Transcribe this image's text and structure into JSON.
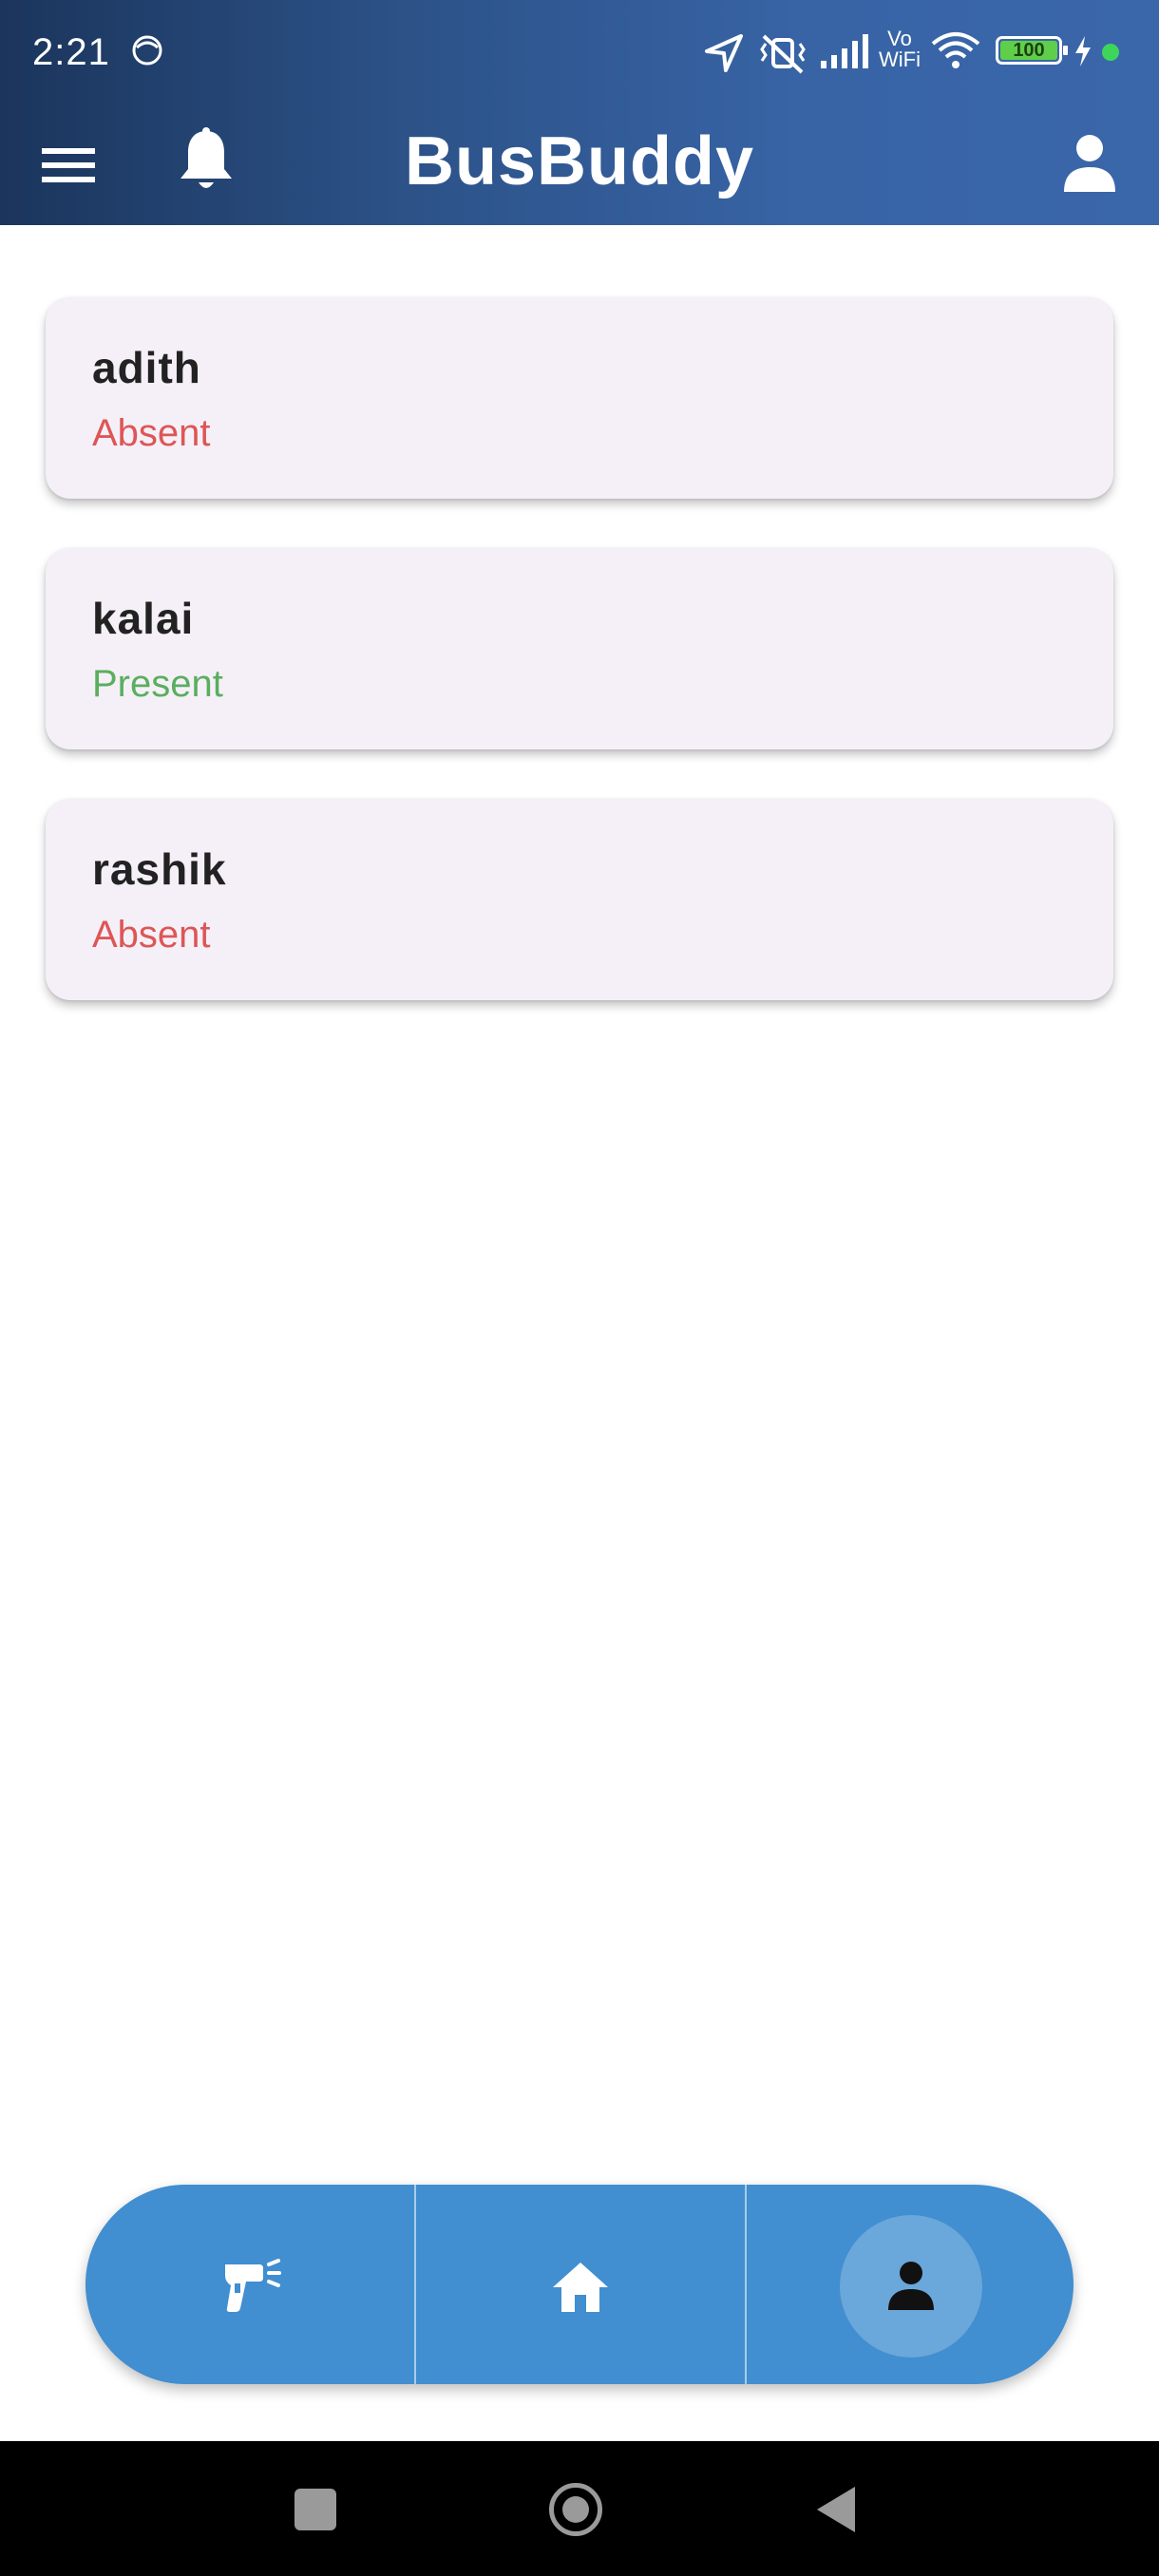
{
  "status_bar": {
    "time": "2:21",
    "battery": "100",
    "network_label_top": "Vo",
    "network_label_bottom": "WiFi"
  },
  "app_bar": {
    "title": "BusBuddy"
  },
  "students": [
    {
      "name": "adith",
      "status": "Absent",
      "status_color": "#dd5656"
    },
    {
      "name": "kalai",
      "status": "Present",
      "status_color": "#5aae5e"
    },
    {
      "name": "rashik",
      "status": "Absent",
      "status_color": "#dd5656"
    }
  ],
  "bottom_nav": {
    "items": [
      {
        "icon": "scanner-icon",
        "active": false
      },
      {
        "icon": "home-icon",
        "active": false
      },
      {
        "icon": "person-icon",
        "active": true
      }
    ]
  },
  "colors": {
    "header_start": "#1b355c",
    "header_end": "#3a67aa",
    "nav_bg": "#418ed0",
    "card_bg": "#f5f0f8"
  }
}
